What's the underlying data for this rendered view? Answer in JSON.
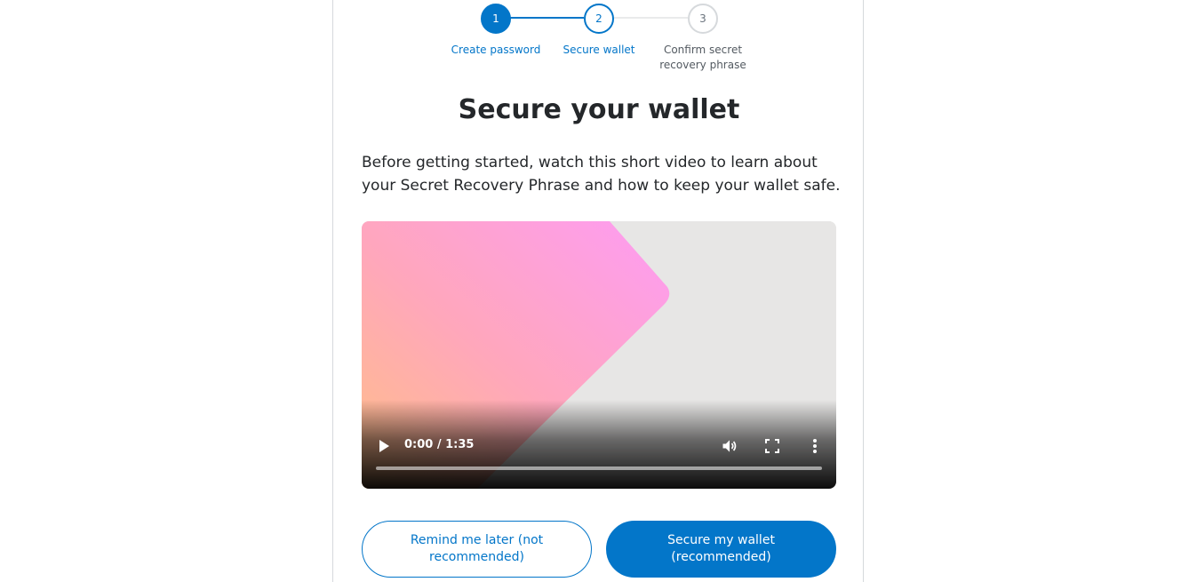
{
  "stepper": {
    "steps": [
      {
        "number": "1",
        "label": "Create password",
        "state": "complete"
      },
      {
        "number": "2",
        "label": "Secure wallet",
        "state": "active"
      },
      {
        "number": "3",
        "label": "Confirm secret recovery phrase",
        "state": "pending"
      }
    ]
  },
  "page": {
    "title": "Secure your wallet",
    "description": "Before getting started, watch this short video to learn about your Secret Recovery Phrase and how to keep your wallet safe."
  },
  "video": {
    "time": "0:00 / 1:35",
    "progress": 0,
    "icons": {
      "play": "play-icon",
      "volume": "volume-icon",
      "fullscreen": "fullscreen-icon",
      "more": "more-vertical-icon"
    }
  },
  "actions": {
    "remind_later_label": "Remind me later (not recommended)",
    "secure_label": "Secure my wallet (recommended)"
  },
  "colors": {
    "accent": "#0376c9",
    "text": "#24272a",
    "border": "#d6d9dc"
  }
}
